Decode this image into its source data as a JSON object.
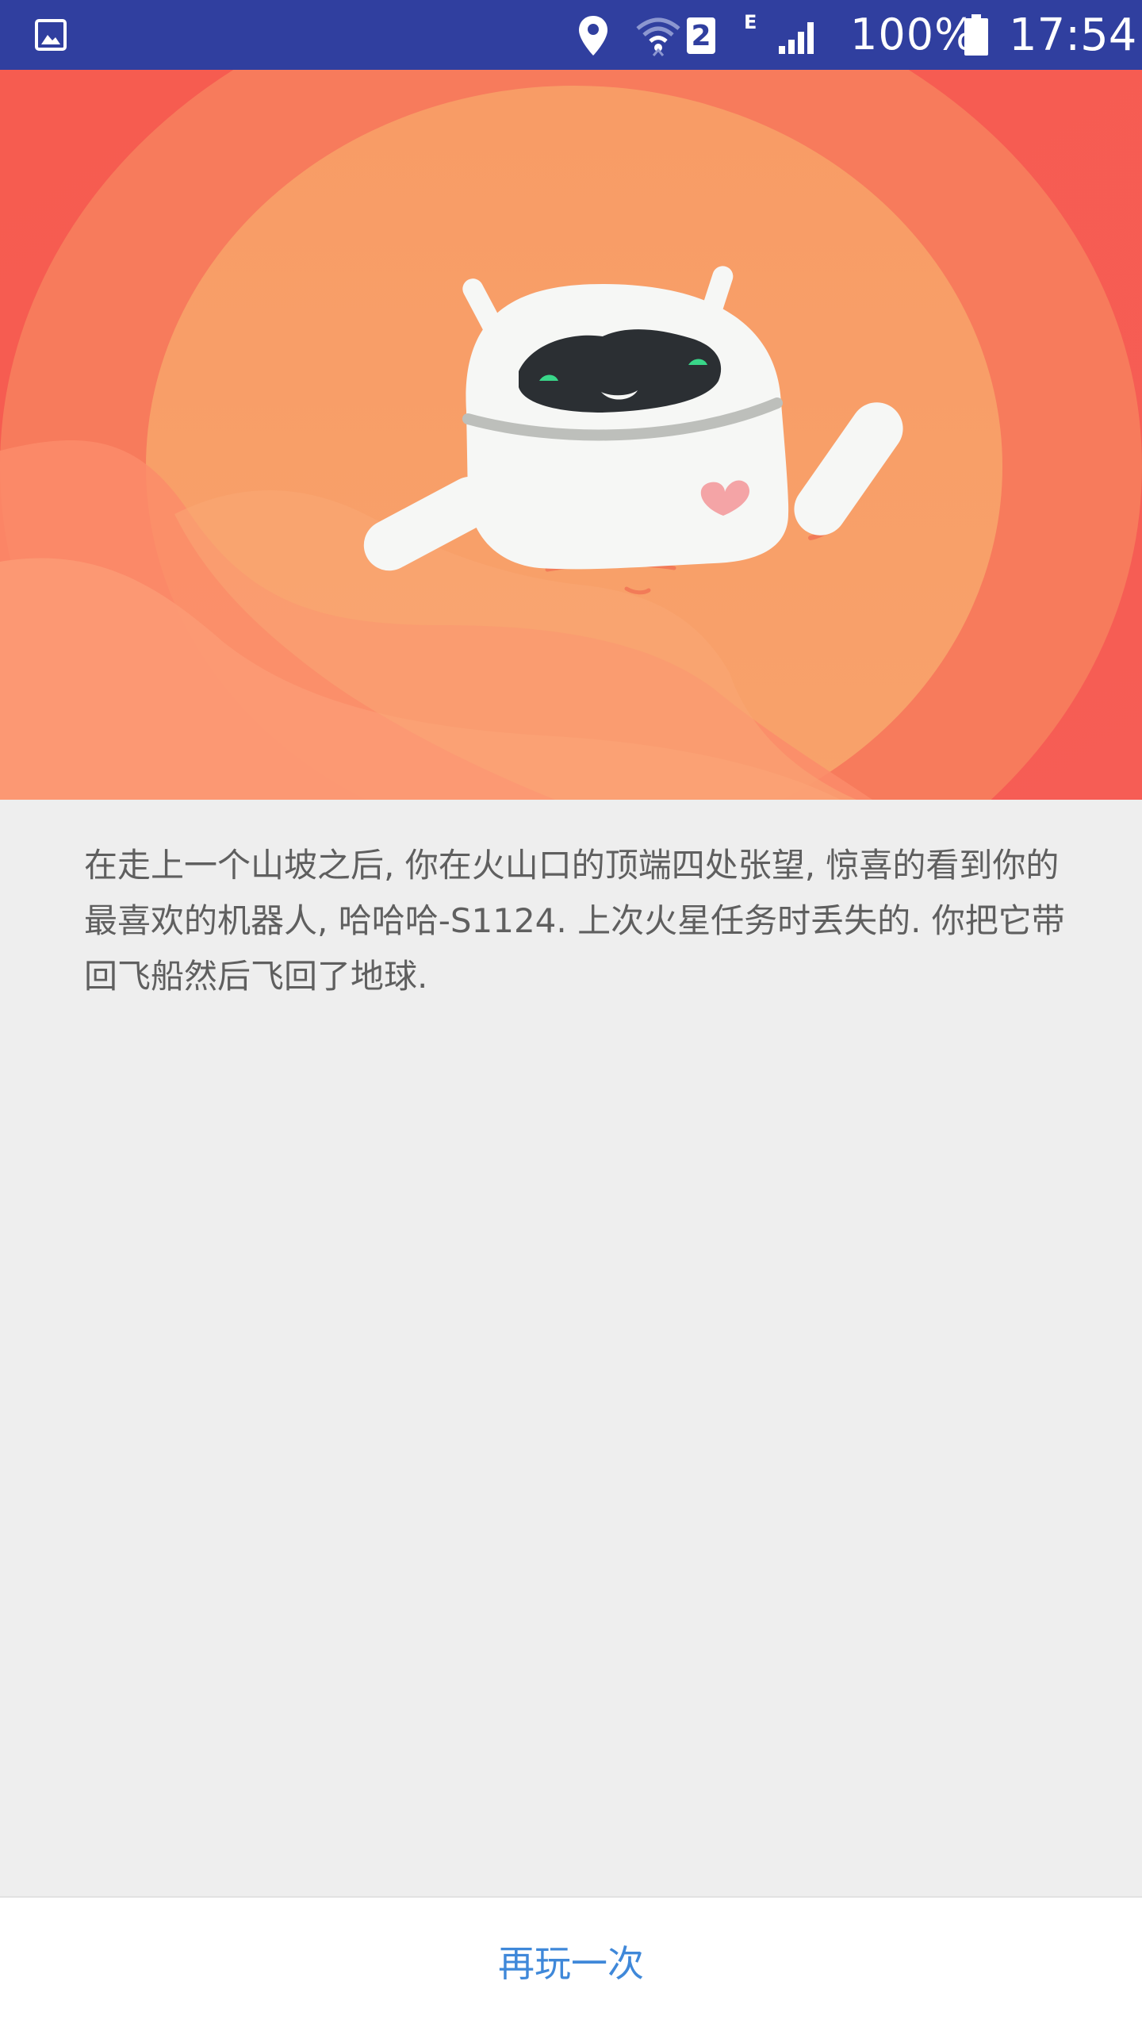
{
  "status_bar": {
    "left_icon": "gallery-icon",
    "icons": [
      "location-icon",
      "wifi-icon",
      "sim-2-icon",
      "network-type-e-icon",
      "signal-icon",
      "battery-icon"
    ],
    "sim_number": "2",
    "network_type": "E",
    "battery": "100%",
    "time": "17:54",
    "background_color": "#303f9f"
  },
  "hero": {
    "illustration": "robot-waving-in-crater-illustration",
    "colors": {
      "outer": "#f65d50",
      "mid": "#f77c5c",
      "inner": "#f79b66",
      "robot_body": "#f6f7f5",
      "visor": "#2b2f33",
      "eye": "#39d689",
      "heart": "#f4a4a6"
    }
  },
  "story": {
    "text": "在走上一个山坡之后, 你在火山口的顶端四处张望, 惊喜的看到你的最喜欢的机器人, 哈哈哈-S1124. 上次火星任务时丢失的. 你把它带回飞船然后飞回了地球."
  },
  "actions": {
    "replay_label": "再玩一次",
    "accent_color": "#3f88d9"
  }
}
